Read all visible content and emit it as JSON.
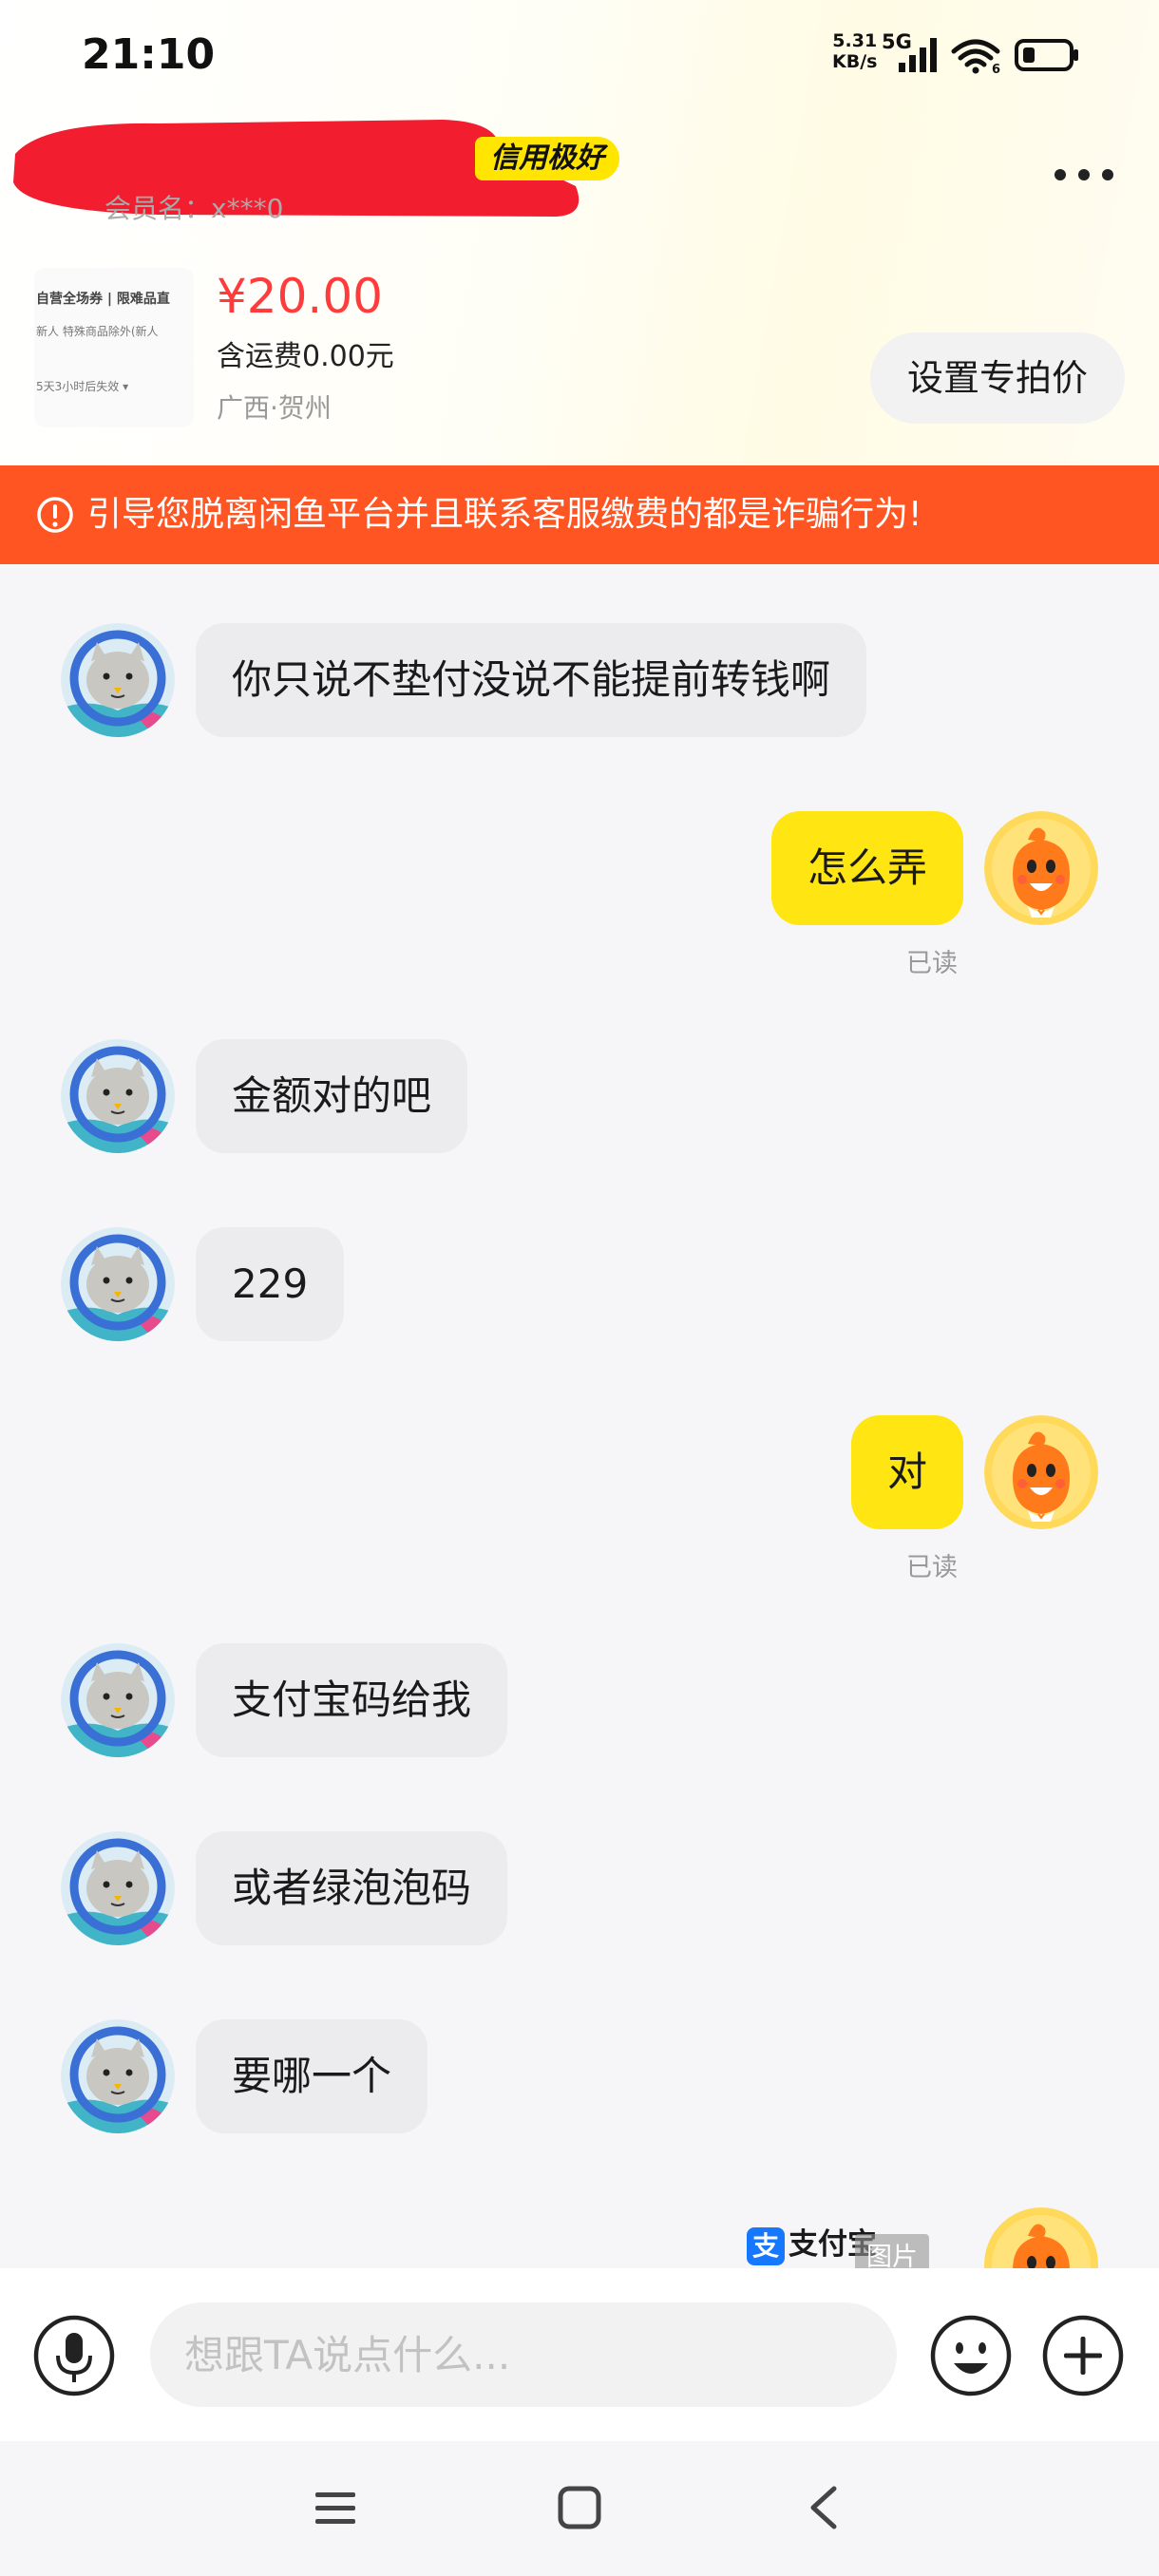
{
  "status_bar": {
    "time": "21:10",
    "net_speed": "5.31",
    "net_unit": "KB/s",
    "network": "5G",
    "wifi_level": "6"
  },
  "header": {
    "credit_badge": "信用极好",
    "member_label": "会员名：x***0",
    "more_icon": "more-dots-icon"
  },
  "product": {
    "thumb_lines": [
      "自营全场券 | 限难品直",
      "新人  特殊商品除外(新人",
      "5天3小时后失效 ▾"
    ],
    "price": "¥20.00",
    "shipping": "含运费0.00元",
    "location": "广西·贺州",
    "set_price_label": "设置专拍价"
  },
  "warning": {
    "text": "引导您脱离闲鱼平台并且联系客服缴费的都是诈骗行为!",
    "icon": "exclamation-circle-icon"
  },
  "messages": [
    {
      "side": "in",
      "text": "你只说不垫付没说不能提前转钱啊"
    },
    {
      "side": "out",
      "text": "怎么弄",
      "status": "已读"
    },
    {
      "side": "in",
      "text": "金额对的吧"
    },
    {
      "side": "in",
      "text": "229"
    },
    {
      "side": "out",
      "text": "对",
      "status": "已读"
    },
    {
      "side": "in",
      "text": "支付宝码给我"
    },
    {
      "side": "in",
      "text": "或者绿泡泡码"
    },
    {
      "side": "in",
      "text": "要哪一个"
    }
  ],
  "partial_message": {
    "alipay_label": "支付宝",
    "alipay_logo": "支",
    "image_tag": "图片"
  },
  "input": {
    "placeholder": "想跟TA说点什么..."
  },
  "colors": {
    "accent_yellow": "#ffe511",
    "warning_orange": "#ff5522",
    "price_red": "#ff3b3b"
  }
}
